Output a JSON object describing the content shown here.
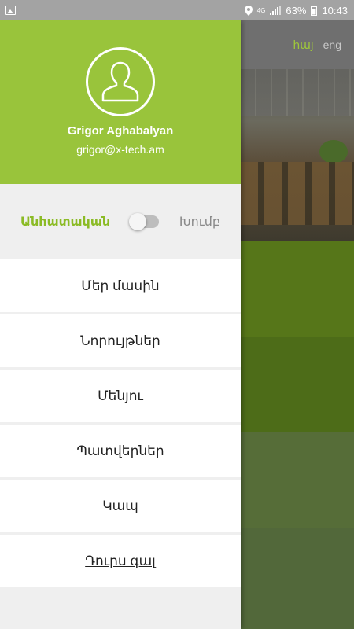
{
  "status_bar": {
    "left_icon": "gallery-icon",
    "signal_label": "4G",
    "battery": "63%",
    "time": "10:43"
  },
  "background_app": {
    "lang_hy": "հայ",
    "lang_en": "eng"
  },
  "drawer": {
    "user": {
      "name": "Grigor Aghabalyan",
      "email": "grigor@x-tech.am"
    },
    "mode": {
      "left_label": "Անհատական",
      "right_label": "Խումբ",
      "toggle_on": false
    },
    "menu": [
      {
        "label": "Մեր մասին"
      },
      {
        "label": "Նորույթներ"
      },
      {
        "label": "Մենյու"
      },
      {
        "label": "Պատվերներ"
      },
      {
        "label": "Կապ"
      },
      {
        "label": "Դուրս գալ"
      }
    ]
  },
  "colors": {
    "accent": "#99c43b",
    "accent_text": "#8bbb25"
  }
}
